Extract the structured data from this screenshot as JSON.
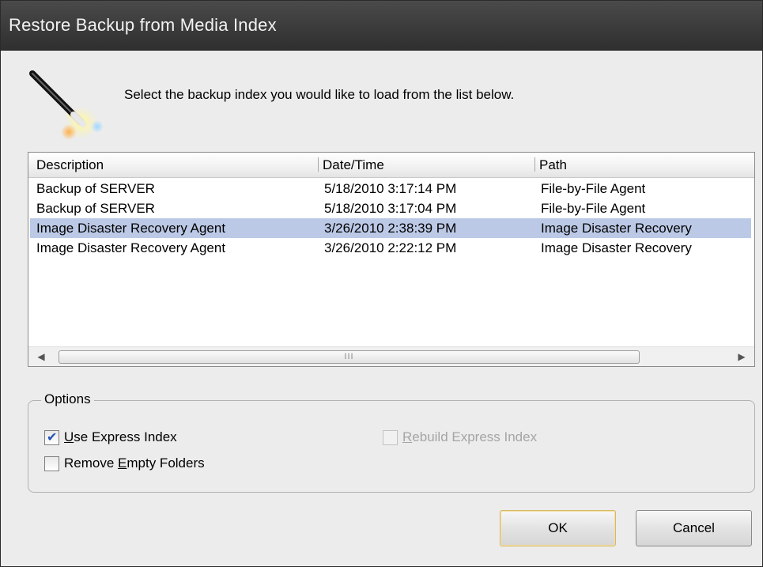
{
  "window": {
    "title": "Restore Backup from Media Index"
  },
  "prompt": "Select the backup index you would like to load from the list below.",
  "list": {
    "columns": [
      "Description",
      "Date/Time",
      "Path"
    ],
    "rows": [
      {
        "description": "Backup of SERVER",
        "datetime": "5/18/2010 3:17:14 PM",
        "path": "File-by-File Agent",
        "selected": false
      },
      {
        "description": "Backup of SERVER",
        "datetime": "5/18/2010 3:17:04 PM",
        "path": "File-by-File Agent",
        "selected": false
      },
      {
        "description": "Image Disaster Recovery Agent",
        "datetime": "3/26/2010 2:38:39 PM",
        "path": "Image Disaster Recovery",
        "selected": true
      },
      {
        "description": "Image Disaster Recovery Agent",
        "datetime": "3/26/2010 2:22:12 PM",
        "path": "Image Disaster Recovery",
        "selected": false
      }
    ],
    "scrollbar_grip": "III"
  },
  "options": {
    "legend": "Options",
    "use_express_index": {
      "pre": "",
      "mnemonic": "U",
      "post": "se Express Index",
      "checked": true,
      "enabled": true
    },
    "rebuild_express_index": {
      "pre": "",
      "mnemonic": "R",
      "post": "ebuild Express Index",
      "checked": false,
      "enabled": false
    },
    "remove_empty_folders": {
      "pre": "Remove ",
      "mnemonic": "E",
      "post": "mpty Folders",
      "checked": false,
      "enabled": true
    }
  },
  "buttons": {
    "ok": "OK",
    "cancel": "Cancel"
  },
  "icons": {
    "wand": "magic-wand-icon",
    "scroll_left": "scroll-left-arrow-icon",
    "scroll_right": "scroll-right-arrow-icon"
  },
  "colors": {
    "selection": "#bcc9e6",
    "titlebar": "#3a3a3a",
    "check": "#2451b5"
  }
}
